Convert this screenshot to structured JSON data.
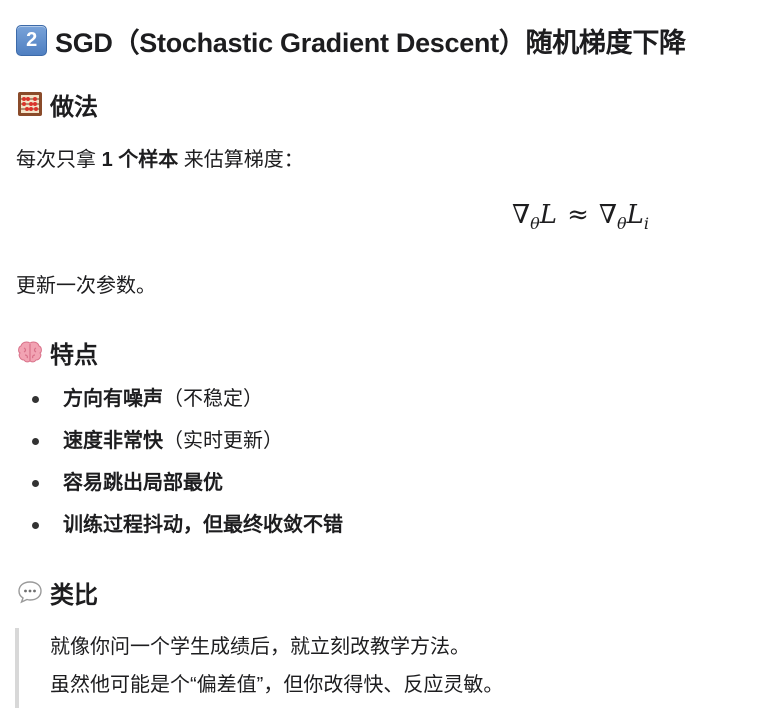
{
  "heading": {
    "keycap": "2",
    "title": "SGD（Stochastic Gradient Descent）随机梯度下降"
  },
  "method": {
    "heading": "做法",
    "icon": "abacus-icon",
    "intro_before": "每次只拿 ",
    "intro_bold": "1 个样本",
    "intro_after": " 来估算梯度：",
    "formula": {
      "nabla": "∇",
      "theta": "θ",
      "L": "L",
      "approx": "≈",
      "i": "i"
    },
    "outro": "更新一次参数。"
  },
  "features": {
    "heading": "特点",
    "icon": "brain-icon",
    "items": [
      {
        "strong": "方向有噪声",
        "note": "（不稳定）"
      },
      {
        "strong": "速度非常快",
        "note": "（实时更新）"
      },
      {
        "strong": "容易跳出局部最优",
        "note": ""
      },
      {
        "strong": "训练过程抖动，但最终收敛不错",
        "note": ""
      }
    ]
  },
  "analogy": {
    "heading": "类比",
    "icon": "speech-bubble-icon",
    "lines": [
      "就像你问一个学生成绩后，就立刻改教学方法。",
      "虽然他可能是个“偏差值”，但你改得快、反应灵敏。"
    ]
  }
}
